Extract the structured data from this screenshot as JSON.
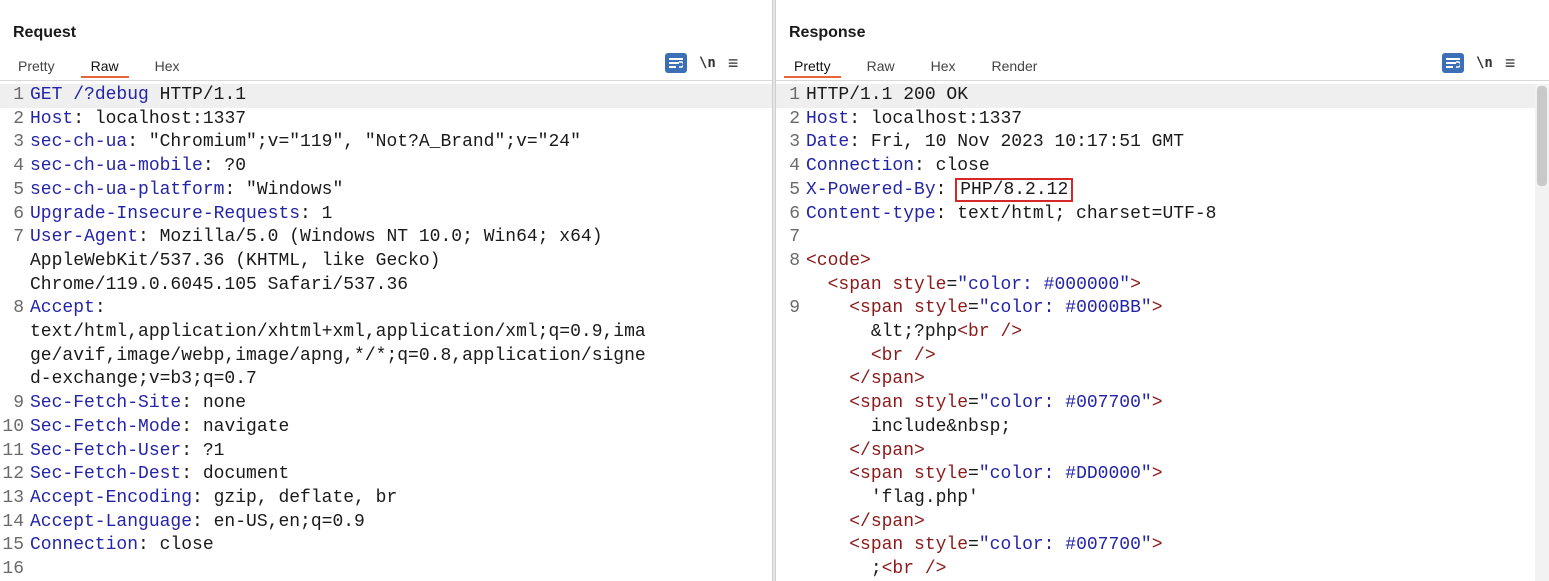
{
  "request": {
    "title": "Request",
    "tabs": [
      "Pretty",
      "Raw",
      "Hex"
    ],
    "active_tab": "Raw",
    "toolbar": {
      "newline_label": "\\n",
      "wrap_icon": "word-wrap-icon",
      "menu_icon": "hamburger-menu-icon"
    },
    "lines": [
      {
        "n": "1",
        "key": "GET /?",
        "mid": "debug",
        "rest": " HTTP/1.1"
      },
      {
        "n": "2",
        "key": "Host",
        "rest": ": localhost:1337"
      },
      {
        "n": "3",
        "key": "sec-ch-ua",
        "rest": ": \"Chromium\";v=\"119\", \"Not?A_Brand\";v=\"24\""
      },
      {
        "n": "4",
        "key": "sec-ch-ua-mobile",
        "rest": ": ?0"
      },
      {
        "n": "5",
        "key": "sec-ch-ua-platform",
        "rest": ": \"Windows\""
      },
      {
        "n": "6",
        "key": "Upgrade-Insecure-Requests",
        "rest": ": 1"
      },
      {
        "n": "7",
        "key": "User-Agent",
        "rest": ": Mozilla/5.0 (Windows NT 10.0; Win64; x64)\nAppleWebKit/537.36 (KHTML, like Gecko)\nChrome/119.0.6045.105 Safari/537.36"
      },
      {
        "n": "8",
        "key": "Accept",
        "rest": ":\ntext/html,application/xhtml+xml,application/xml;q=0.9,ima\nge/avif,image/webp,image/apng,*/*;q=0.8,application/signe\nd-exchange;v=b3;q=0.7"
      },
      {
        "n": "9",
        "key": "Sec-Fetch-Site",
        "rest": ": none"
      },
      {
        "n": "10",
        "key": "Sec-Fetch-Mode",
        "rest": ": navigate"
      },
      {
        "n": "11",
        "key": "Sec-Fetch-User",
        "rest": ": ?1"
      },
      {
        "n": "12",
        "key": "Sec-Fetch-Dest",
        "rest": ": document"
      },
      {
        "n": "13",
        "key": "Accept-Encoding",
        "rest": ": gzip, deflate, br"
      },
      {
        "n": "14",
        "key": "Accept-Language",
        "rest": ": en-US,en;q=0.9"
      },
      {
        "n": "15",
        "key": "Connection",
        "rest": ": close"
      },
      {
        "n": "16",
        "key": "",
        "rest": ""
      }
    ]
  },
  "response": {
    "title": "Response",
    "tabs": [
      "Pretty",
      "Raw",
      "Hex",
      "Render"
    ],
    "active_tab": "Pretty",
    "toolbar": {
      "newline_label": "\\n",
      "wrap_icon": "word-wrap-icon",
      "menu_icon": "hamburger-menu-icon"
    },
    "status_line": "HTTP/1.1 200 OK",
    "headers": [
      {
        "n": "2",
        "key": "Host",
        "value": " localhost:1337"
      },
      {
        "n": "3",
        "key": "Date",
        "value": " Fri, 10 Nov 2023 10:17:51 GMT"
      },
      {
        "n": "4",
        "key": "Connection",
        "value": " close"
      },
      {
        "n": "5",
        "key": "X-Powered-By",
        "value": "PHP/8.2.12",
        "highlighted": true
      },
      {
        "n": "6",
        "key": "Content-type",
        "value": " text/html; charset=UTF-8"
      }
    ],
    "body_lines": [
      {
        "n": "7",
        "parts": []
      },
      {
        "n": "8",
        "parts": [
          {
            "c": "tg",
            "t": "<code>"
          }
        ]
      },
      {
        "n": "",
        "indent": "  ",
        "parts": [
          {
            "c": "tg",
            "t": "<span "
          },
          {
            "c": "at",
            "t": "style"
          },
          {
            "c": "",
            "t": "="
          },
          {
            "c": "sv",
            "t": "\"color: #000000\""
          },
          {
            "c": "tg",
            "t": ">"
          }
        ]
      },
      {
        "n": "9",
        "indent": "    ",
        "parts": [
          {
            "c": "tg",
            "t": "<span "
          },
          {
            "c": "at",
            "t": "style"
          },
          {
            "c": "",
            "t": "="
          },
          {
            "c": "sv",
            "t": "\"color: #0000BB\""
          },
          {
            "c": "tg",
            "t": ">"
          }
        ]
      },
      {
        "n": "",
        "indent": "      ",
        "parts": [
          {
            "c": "",
            "t": "&lt;?php"
          },
          {
            "c": "tg",
            "t": "<br />"
          }
        ]
      },
      {
        "n": "",
        "indent": "      ",
        "parts": [
          {
            "c": "tg",
            "t": "<br />"
          }
        ]
      },
      {
        "n": "",
        "indent": "    ",
        "parts": [
          {
            "c": "tg",
            "t": "</span>"
          }
        ]
      },
      {
        "n": "",
        "indent": "    ",
        "parts": [
          {
            "c": "tg",
            "t": "<span "
          },
          {
            "c": "at",
            "t": "style"
          },
          {
            "c": "",
            "t": "="
          },
          {
            "c": "sv",
            "t": "\"color: #007700\""
          },
          {
            "c": "tg",
            "t": ">"
          }
        ]
      },
      {
        "n": "",
        "indent": "      ",
        "parts": [
          {
            "c": "",
            "t": "include&nbsp;"
          }
        ]
      },
      {
        "n": "",
        "indent": "    ",
        "parts": [
          {
            "c": "tg",
            "t": "</span>"
          }
        ]
      },
      {
        "n": "",
        "indent": "    ",
        "parts": [
          {
            "c": "tg",
            "t": "<span "
          },
          {
            "c": "at",
            "t": "style"
          },
          {
            "c": "",
            "t": "="
          },
          {
            "c": "sv",
            "t": "\"color: #DD0000\""
          },
          {
            "c": "tg",
            "t": ">"
          }
        ]
      },
      {
        "n": "",
        "indent": "      ",
        "parts": [
          {
            "c": "",
            "t": "'flag.php'"
          }
        ]
      },
      {
        "n": "",
        "indent": "    ",
        "parts": [
          {
            "c": "tg",
            "t": "</span>"
          }
        ]
      },
      {
        "n": "",
        "indent": "    ",
        "parts": [
          {
            "c": "tg",
            "t": "<span "
          },
          {
            "c": "at",
            "t": "style"
          },
          {
            "c": "",
            "t": "="
          },
          {
            "c": "sv",
            "t": "\"color: #007700\""
          },
          {
            "c": "tg",
            "t": ">"
          }
        ]
      },
      {
        "n": "",
        "indent": "      ",
        "parts": [
          {
            "c": "",
            "t": ";"
          },
          {
            "c": "tg",
            "t": "<br />"
          }
        ]
      }
    ]
  },
  "layout_toggle": {
    "options": [
      "side-by-side",
      "stacked-horizontal",
      "single"
    ],
    "active": "side-by-side"
  },
  "colors": {
    "accent": "#3b6fb6",
    "tab_underline": "#e8653a",
    "key": "#2424a8",
    "tag": "#8b1a1a",
    "highlight_box": "#d62828"
  }
}
